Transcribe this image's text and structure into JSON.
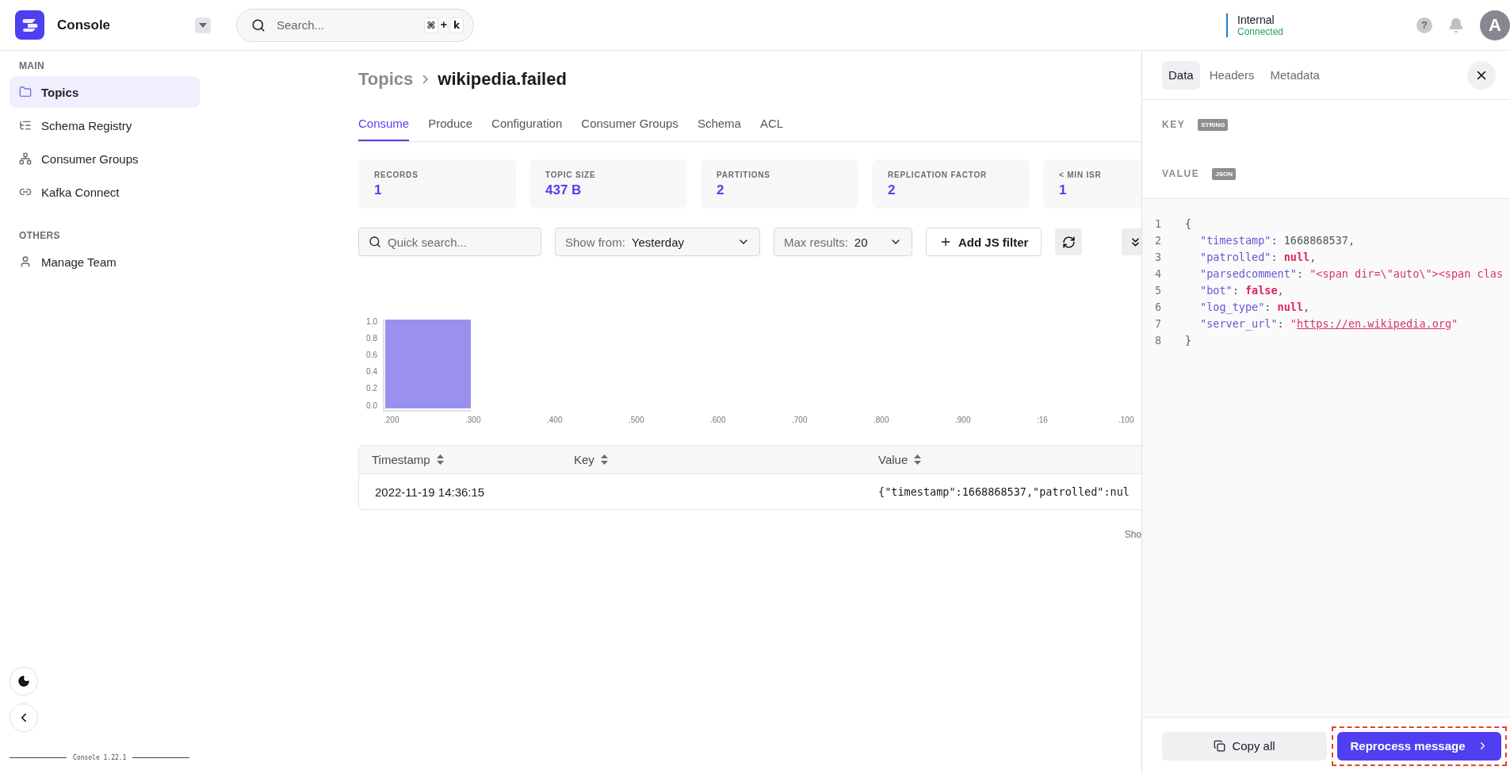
{
  "topbar": {
    "app_name": "Console",
    "search": {
      "placeholder": "Search...",
      "shortcut": [
        "⌘",
        "+",
        "k"
      ]
    },
    "cluster": {
      "name": "Internal",
      "status": "Connected"
    },
    "help": "?",
    "avatar": "A"
  },
  "sidebar": {
    "sections": [
      {
        "title": "MAIN",
        "items": [
          {
            "label": "Topics",
            "selected": true
          },
          {
            "label": "Schema Registry",
            "selected": false
          },
          {
            "label": "Consumer Groups",
            "selected": false
          },
          {
            "label": "Kafka Connect",
            "selected": false
          }
        ]
      },
      {
        "title": "OTHERS",
        "items": [
          {
            "label": "Manage Team",
            "selected": false
          }
        ]
      }
    ],
    "version": "Console 1.22.1"
  },
  "breadcrumb": {
    "parent": "Topics",
    "current": "wikipedia.failed"
  },
  "tabs": [
    {
      "label": "Consume",
      "selected": true
    },
    {
      "label": "Produce",
      "selected": false
    },
    {
      "label": "Configuration",
      "selected": false
    },
    {
      "label": "Consumer Groups",
      "selected": false
    },
    {
      "label": "Schema",
      "selected": false
    },
    {
      "label": "ACL",
      "selected": false
    }
  ],
  "stats": [
    {
      "label": "RECORDS",
      "value": "1"
    },
    {
      "label": "TOPIC SIZE",
      "value": "437 B"
    },
    {
      "label": "PARTITIONS",
      "value": "2"
    },
    {
      "label": "REPLICATION FACTOR",
      "value": "2"
    },
    {
      "label": "< MIN ISR",
      "value": "1"
    }
  ],
  "filters": {
    "quick_search": {
      "placeholder": "Quick search..."
    },
    "show_from": {
      "label": "Show from:",
      "value": "Yesterday"
    },
    "max_results": {
      "label": "Max results:",
      "value": "20"
    },
    "add_filter": "Add JS filter"
  },
  "chart_data": {
    "type": "bar",
    "categories": [
      ".200",
      ".300",
      ".400",
      ".500",
      ".600",
      ".700",
      ".800",
      ".900",
      ":16",
      ".100"
    ],
    "values": [
      1,
      null,
      null,
      null,
      null,
      null,
      null,
      null,
      null,
      null
    ],
    "ylim": [
      0,
      1
    ],
    "yticks": [
      {
        "value": 0,
        "label": "0.0"
      },
      {
        "value": 0.2,
        "label": "0.2"
      },
      {
        "value": 0.4,
        "label": "0.4"
      },
      {
        "value": 0.6,
        "label": "0.6"
      },
      {
        "value": 0.8,
        "label": "0.8"
      },
      {
        "value": 1,
        "label": "1.0"
      }
    ]
  },
  "table": {
    "columns": [
      "Timestamp",
      "Key",
      "Value"
    ],
    "rows": [
      [
        "2022-11-19 14:36:15",
        "",
        "{\"timestamp\":1668868537,\"patrolled\":nul"
      ]
    ],
    "footer": "Sho"
  },
  "panel": {
    "tabs": [
      {
        "label": "Data",
        "selected": true
      },
      {
        "label": "Headers",
        "selected": false
      },
      {
        "label": "Metadata",
        "selected": false
      }
    ],
    "key": {
      "label": "KEY",
      "type": "STRING"
    },
    "value": {
      "label": "VALUE",
      "type": "JSON"
    },
    "code": [
      {
        "number": "1",
        "kind": "brace",
        "tokens": [
          {
            "kind": "punct",
            "text": "{"
          }
        ]
      },
      {
        "number": "2",
        "kind": "entry",
        "tokens": [
          {
            "kind": "key",
            "text": "\"timestamp\""
          },
          {
            "kind": "punct",
            "text": ": "
          },
          {
            "kind": "number",
            "text": "1668868537"
          },
          {
            "kind": "punct",
            "text": ","
          }
        ]
      },
      {
        "number": "3",
        "kind": "entry",
        "tokens": [
          {
            "kind": "key",
            "text": "\"patrolled\""
          },
          {
            "kind": "punct",
            "text": ": "
          },
          {
            "kind": "literal",
            "text": "null"
          },
          {
            "kind": "punct",
            "text": ","
          }
        ]
      },
      {
        "number": "4",
        "kind": "entry",
        "tokens": [
          {
            "kind": "key",
            "text": "\"parsedcomment\""
          },
          {
            "kind": "punct",
            "text": ": "
          },
          {
            "kind": "string",
            "text": "\"<span dir=\\\"auto\\\"><span clas"
          }
        ]
      },
      {
        "number": "5",
        "kind": "entry",
        "tokens": [
          {
            "kind": "key",
            "text": "\"bot\""
          },
          {
            "kind": "punct",
            "text": ": "
          },
          {
            "kind": "literal",
            "text": "false"
          },
          {
            "kind": "punct",
            "text": ","
          }
        ]
      },
      {
        "number": "6",
        "kind": "entry",
        "tokens": [
          {
            "kind": "key",
            "text": "\"log_type\""
          },
          {
            "kind": "punct",
            "text": ": "
          },
          {
            "kind": "literal",
            "text": "null"
          },
          {
            "kind": "punct",
            "text": ","
          }
        ]
      },
      {
        "number": "7",
        "kind": "entry",
        "tokens": [
          {
            "kind": "key",
            "text": "\"server_url\""
          },
          {
            "kind": "punct",
            "text": ": "
          },
          {
            "kind": "string",
            "text": "\""
          },
          {
            "kind": "link",
            "text": "https://en.wikipedia.org"
          },
          {
            "kind": "string",
            "text": "\""
          }
        ]
      },
      {
        "number": "8",
        "kind": "brace",
        "tokens": [
          {
            "kind": "punct",
            "text": "}"
          }
        ]
      }
    ],
    "copy_button": "Copy all",
    "reprocess_button": {
      "label": "Reprocess message",
      "highlighted": true
    }
  }
}
